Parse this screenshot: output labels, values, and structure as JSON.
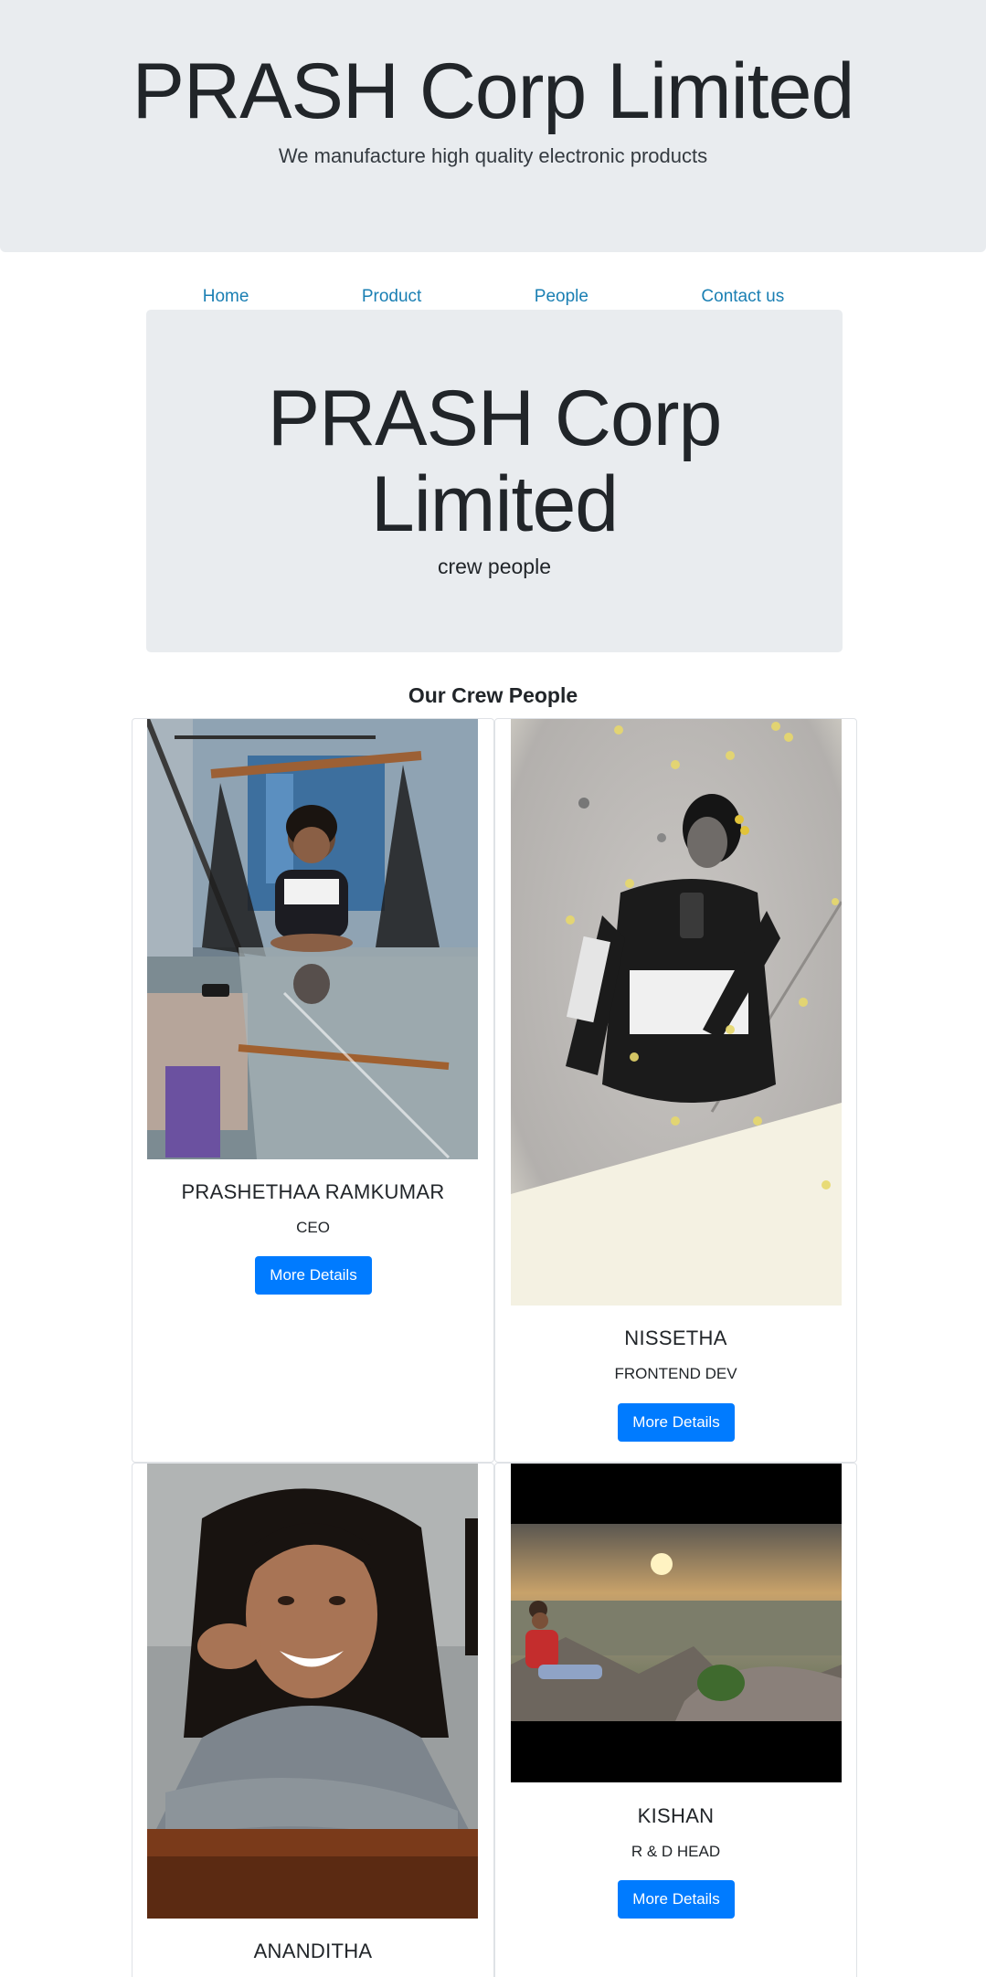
{
  "header": {
    "title": "PRASH Corp Limited",
    "tagline": "We manufacture high quality electronic products"
  },
  "nav": {
    "items": [
      {
        "label": "Home"
      },
      {
        "label": "Product"
      },
      {
        "label": "People"
      },
      {
        "label": "Contact us"
      }
    ]
  },
  "hero": {
    "title": "PRASH Corp Limited",
    "subtitle": "crew people"
  },
  "crew": {
    "heading": "Our Crew People",
    "members": [
      {
        "name": "PRASHETHAA RAMKUMAR",
        "role": "CEO",
        "button": "More Details"
      },
      {
        "name": "NISSETHA",
        "role": "FRONTEND DEV",
        "button": "More Details"
      },
      {
        "name": "ANANDITHA",
        "role": "",
        "button": ""
      },
      {
        "name": "KISHAN",
        "role": "R & D HEAD",
        "button": "More Details"
      }
    ]
  }
}
